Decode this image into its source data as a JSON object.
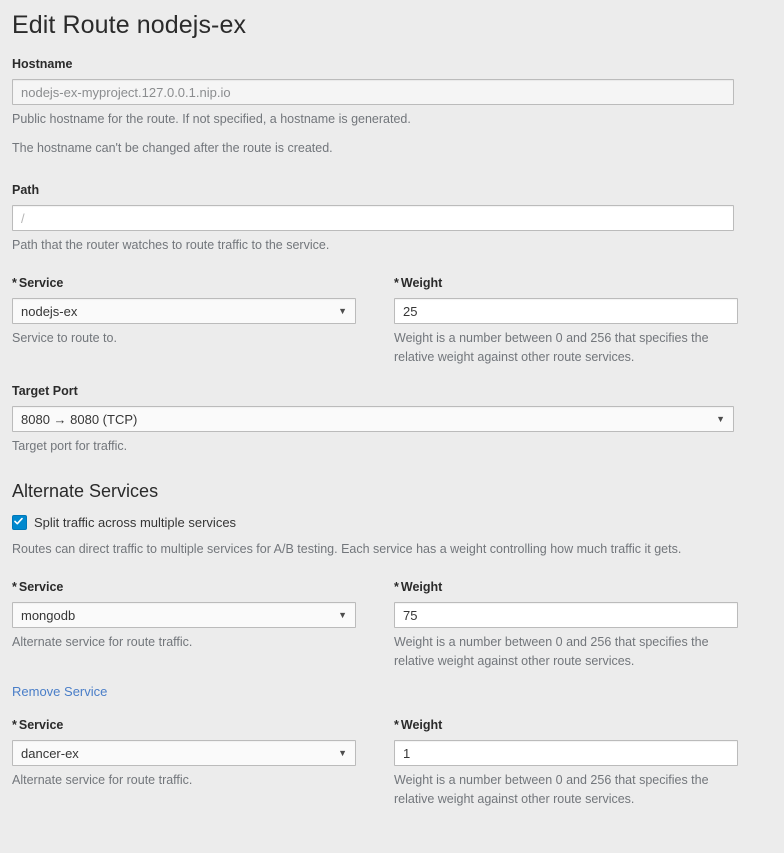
{
  "page": {
    "title": "Edit Route nodejs-ex"
  },
  "hostname": {
    "label": "Hostname",
    "value": "nodejs-ex-myproject.127.0.0.1.nip.io",
    "help": "Public hostname for the route. If not specified, a hostname is generated.",
    "note": "The hostname can't be changed after the route is created."
  },
  "path": {
    "label": "Path",
    "value": "",
    "placeholder": "/",
    "help": "Path that the router watches to route traffic to the service."
  },
  "primary_service": {
    "label": "Service",
    "required_marker": "*",
    "value": "nodejs-ex",
    "help": "Service to route to.",
    "chevron": "chevron-down-icon"
  },
  "primary_weight": {
    "label": "Weight",
    "required_marker": "*",
    "value": "25",
    "help": "Weight is a number between 0 and 256 that specifies the relative weight against other route services."
  },
  "target_port": {
    "label": "Target Port",
    "value": "8080 → 8080 (TCP)",
    "help": "Target port for traffic.",
    "chevron": "chevron-down-icon"
  },
  "alternate_services": {
    "heading": "Alternate Services",
    "checkbox_label": "Split traffic across multiple services",
    "checkbox_checked": true,
    "help": "Routes can direct traffic to multiple services for A/B testing. Each service has a weight controlling how much traffic it gets.",
    "remove_link": "Remove Service",
    "entries": [
      {
        "service_label": "Service",
        "required_marker": "*",
        "service_value": "mongodb",
        "service_help": "Alternate service for route traffic.",
        "weight_label": "Weight",
        "weight_value": "75",
        "weight_help": "Weight is a number between 0 and 256 that specifies the relative weight against other route services."
      },
      {
        "service_label": "Service",
        "required_marker": "*",
        "service_value": "dancer-ex",
        "service_help": "Alternate service for route traffic.",
        "weight_label": "Weight",
        "weight_value": "1",
        "weight_help": "Weight is a number between 0 and 256 that specifies the relative weight against other route services."
      }
    ]
  },
  "colors": {
    "background": "#ececec",
    "accent_blue": "#0088ce",
    "link_blue": "#4a7ec8",
    "help_gray": "#72767b",
    "border_gray": "#bbbbbb"
  }
}
